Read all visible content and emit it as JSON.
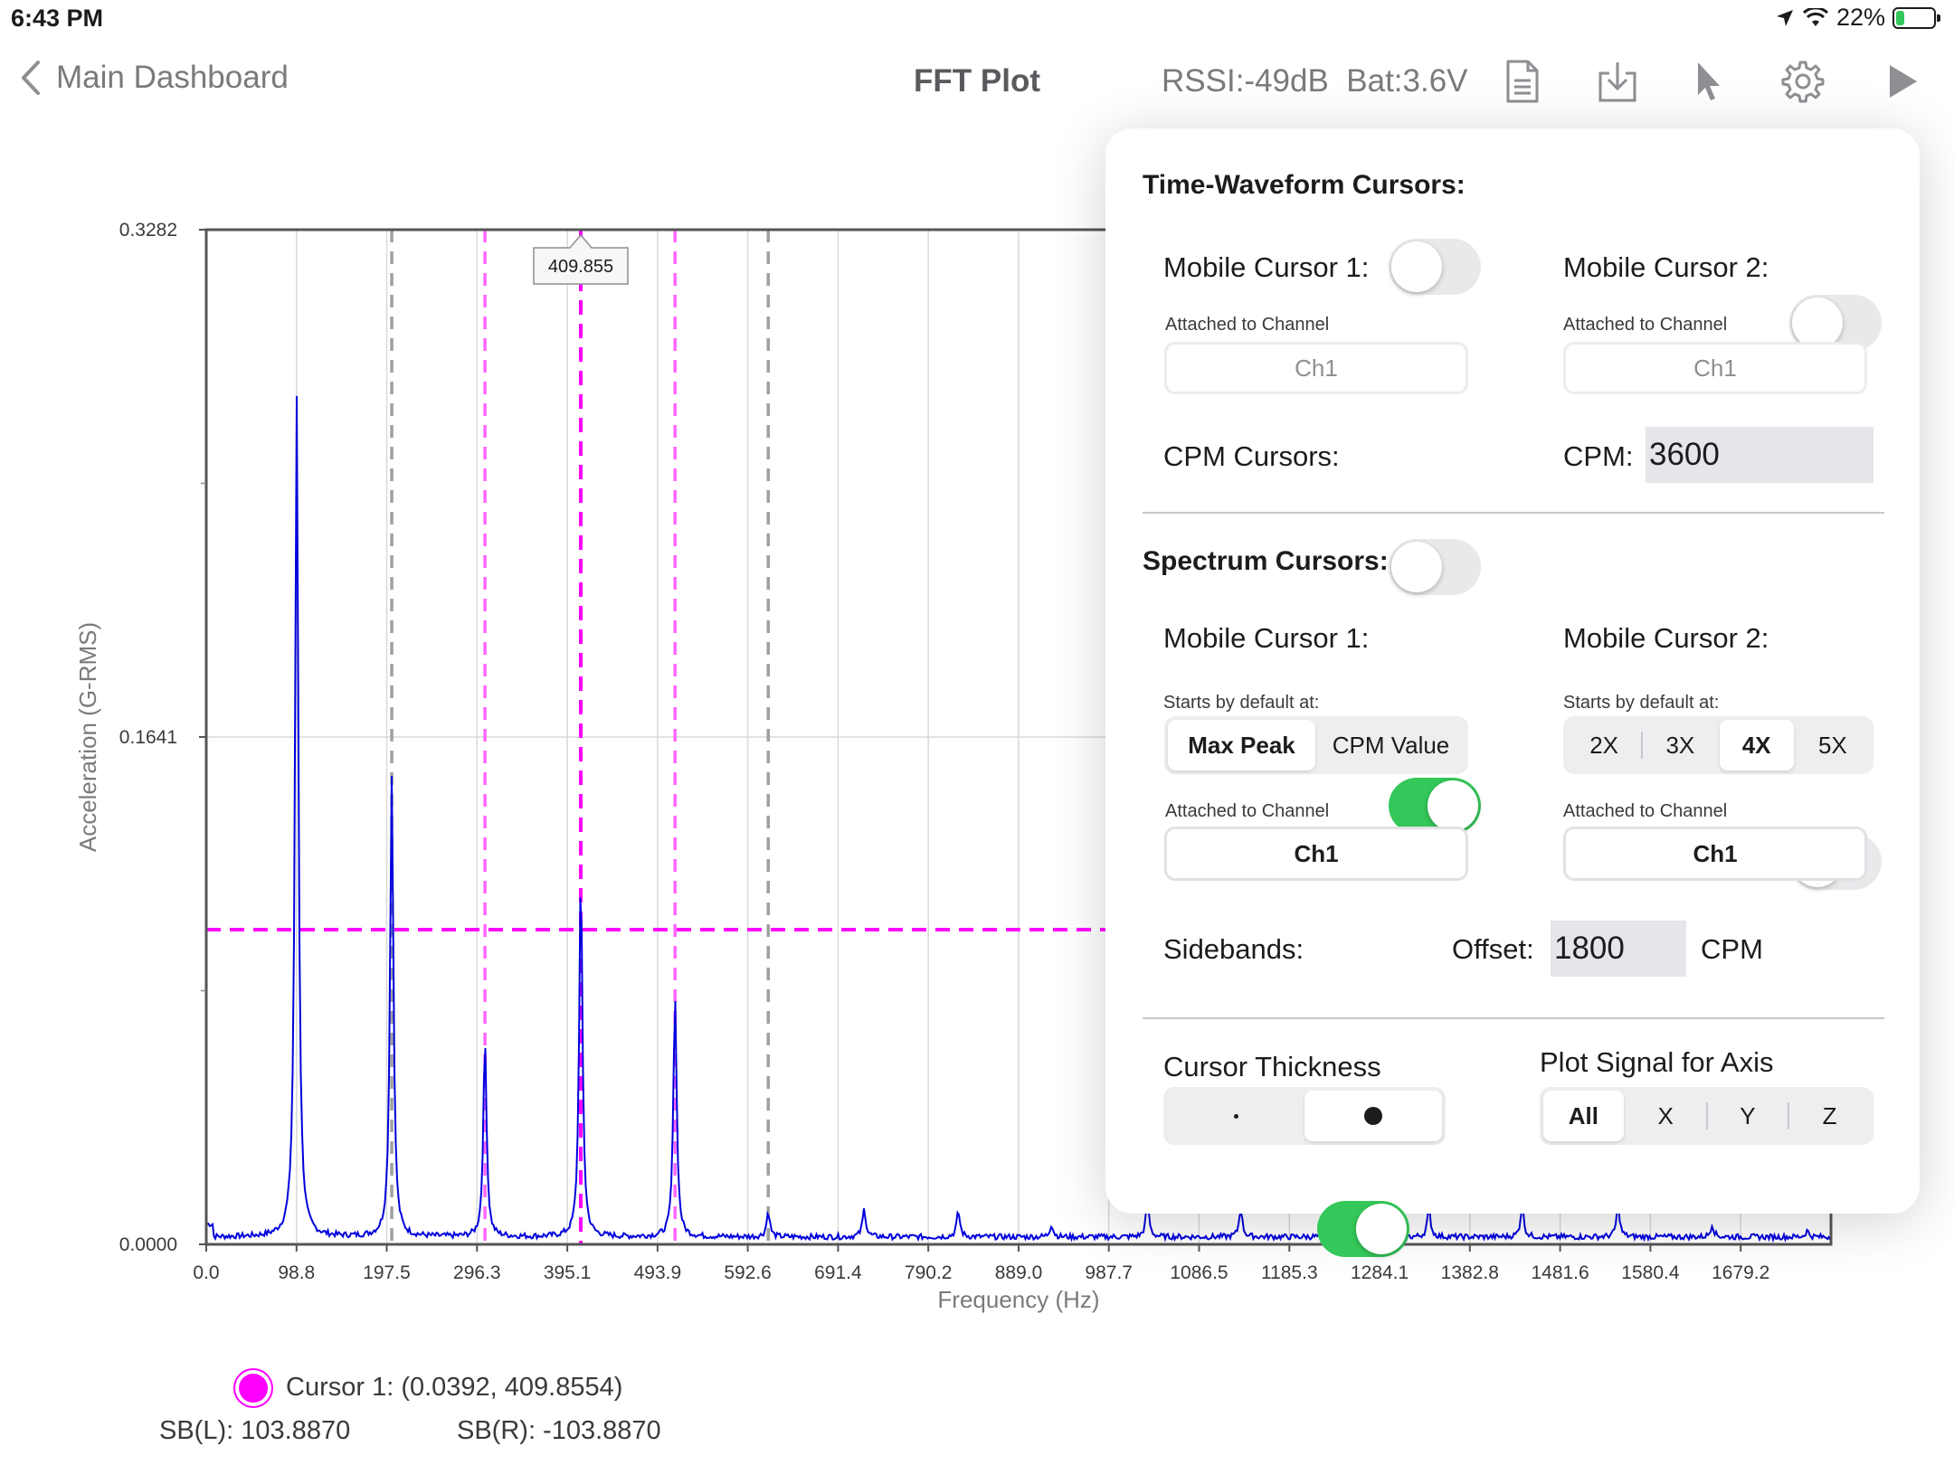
{
  "status_bar": {
    "time": "6:43 PM",
    "battery_text": "22%",
    "battery_level": 0.22
  },
  "nav": {
    "back_label": "Main Dashboard",
    "title": "FFT Plot",
    "rssi": "RSSI:-49dB",
    "battery": "Bat:3.6V",
    "icons": [
      "document-icon",
      "download-icon",
      "cursor-pointer-icon",
      "gear-icon",
      "play-icon"
    ]
  },
  "chart_data": {
    "type": "line",
    "xlabel": "Frequency (Hz)",
    "ylabel": "Acceleration (G-RMS)",
    "xlim": [
      0.0,
      1778.0
    ],
    "ylim": [
      0.0,
      0.3282
    ],
    "x_ticks": [
      "0.0",
      "98.8",
      "197.5",
      "296.3",
      "395.1",
      "493.9",
      "592.6",
      "691.4",
      "790.2",
      "889.0",
      "987.7",
      "1086.5",
      "1185.3",
      "1284.1",
      "1382.8",
      "1481.6",
      "1580.4",
      "1679.2"
    ],
    "y_ticks": [
      "0.0000",
      "0.1641",
      "0.3282"
    ],
    "series": [
      {
        "color": "#0000dd",
        "peaks": [
          {
            "x": 99.0,
            "y": 0.272
          },
          {
            "x": 203.0,
            "y": 0.149
          },
          {
            "x": 305.0,
            "y": 0.063
          },
          {
            "x": 409.9,
            "y": 0.116
          },
          {
            "x": 513.0,
            "y": 0.078
          },
          {
            "x": 615.0,
            "y": 0.008
          },
          {
            "x": 720.0,
            "y": 0.009
          },
          {
            "x": 823.0,
            "y": 0.008
          },
          {
            "x": 925.0,
            "y": 0.004
          },
          {
            "x": 1030.0,
            "y": 0.011
          },
          {
            "x": 1132.0,
            "y": 0.009
          },
          {
            "x": 1236.0,
            "y": 0.011
          },
          {
            "x": 1338.0,
            "y": 0.009
          },
          {
            "x": 1440.0,
            "y": 0.01
          },
          {
            "x": 1545.0,
            "y": 0.01
          },
          {
            "x": 1648.0,
            "y": 0.004
          },
          {
            "x": 1752.0,
            "y": 0.002
          }
        ]
      }
    ],
    "cursors": {
      "harmonic_lines": [
        203.0,
        615.0
      ],
      "sideband_lines": [
        305.0,
        513.0
      ],
      "main_line": 409.855,
      "horizontal_level": 0.1018,
      "colors": {
        "harmonic": "#a0a0a0",
        "sideband": "#ff66ff",
        "main": "#ff00ff"
      }
    },
    "tooltip": "409.855"
  },
  "cursor_readout": {
    "cursor1": "Cursor 1: (0.0392, 409.8554)",
    "sb_left": "SB(L): 103.8870",
    "sb_right": "SB(R): -103.8870"
  },
  "popover": {
    "time_waveform": {
      "title": "Time-Waveform Cursors:",
      "mobile1_label": "Mobile Cursor 1:",
      "mobile1_on": false,
      "mobile2_label": "Mobile Cursor 2:",
      "mobile2_on": false,
      "attached_label_1": "Attached to Channel",
      "attached_label_2": "Attached to Channel",
      "channel1": "Ch1",
      "channel2": "Ch1",
      "cpm_cursors_label": "CPM Cursors:",
      "cpm_cursors_on": false,
      "cpm_label": "CPM:",
      "cpm_value": "3600"
    },
    "spectrum": {
      "title": "Spectrum Cursors:",
      "mobile1_label": "Mobile Cursor 1:",
      "mobile1_on": true,
      "mobile2_label": "Mobile Cursor 2:",
      "mobile2_on": false,
      "starts_label_1": "Starts by default at:",
      "starts_label_2": "Starts by default at:",
      "starts1_options": [
        "Max Peak",
        "CPM Value"
      ],
      "starts1_selected": "Max Peak",
      "starts2_options": [
        "2X",
        "3X",
        "4X",
        "5X"
      ],
      "starts2_selected": "4X",
      "attached_label_1": "Attached to Channel",
      "attached_label_2": "Attached to Channel",
      "channel1": "Ch1",
      "channel2": "Ch1",
      "sidebands_label": "Sidebands:",
      "sidebands_on": true,
      "offset_label": "Offset:",
      "offset_value": "1800",
      "offset_unit": "CPM"
    },
    "cursor_thickness": {
      "title": "Cursor Thickness",
      "options": [
        "thin-dot-icon",
        "thick-dot-icon"
      ],
      "selected": "thick-dot-icon"
    },
    "plot_signal": {
      "title": "Plot Signal for Axis",
      "options": [
        "All",
        "X",
        "Y",
        "Z"
      ],
      "selected": "All"
    }
  }
}
